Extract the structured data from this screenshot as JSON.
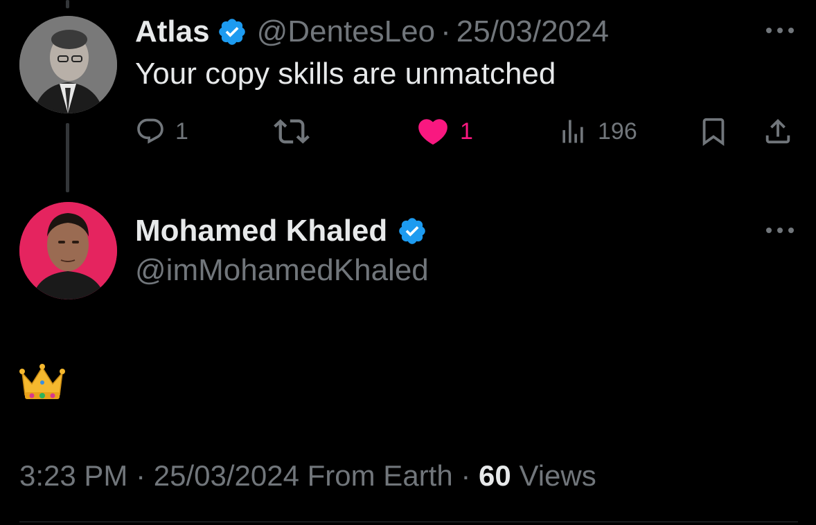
{
  "parent_tweet": {
    "author_name": "Atlas",
    "handle": "@DentesLeo",
    "separator": "·",
    "date": "25/03/2024",
    "text": "Your copy skills are unmatched",
    "verified": true,
    "actions": {
      "reply_count": "1",
      "retweet_count": "",
      "like_count": "1",
      "views_count": "196"
    },
    "icons": {
      "reply": "reply-icon",
      "retweet": "retweet-icon",
      "like": "heart-icon",
      "views": "views-icon",
      "bookmark": "bookmark-icon",
      "share": "share-icon",
      "more": "more-icon"
    },
    "colors": {
      "like_active": "#f91880"
    }
  },
  "main_tweet": {
    "author_name": "Mohamed Khaled",
    "handle": "@imMohamedKhaled",
    "verified": true,
    "text_emoji": "crown-emoji",
    "meta": {
      "time": "3:23 PM",
      "separator": "·",
      "date": "25/03/2024",
      "source": "From Earth",
      "views_count": "60",
      "views_label": "Views"
    }
  },
  "colors": {
    "background": "#000000",
    "primary_text": "#e7e9ea",
    "secondary_text": "#71767b",
    "verified_badge": "#1d9bf0",
    "avatar_bg_khaled": "#e5245f"
  }
}
